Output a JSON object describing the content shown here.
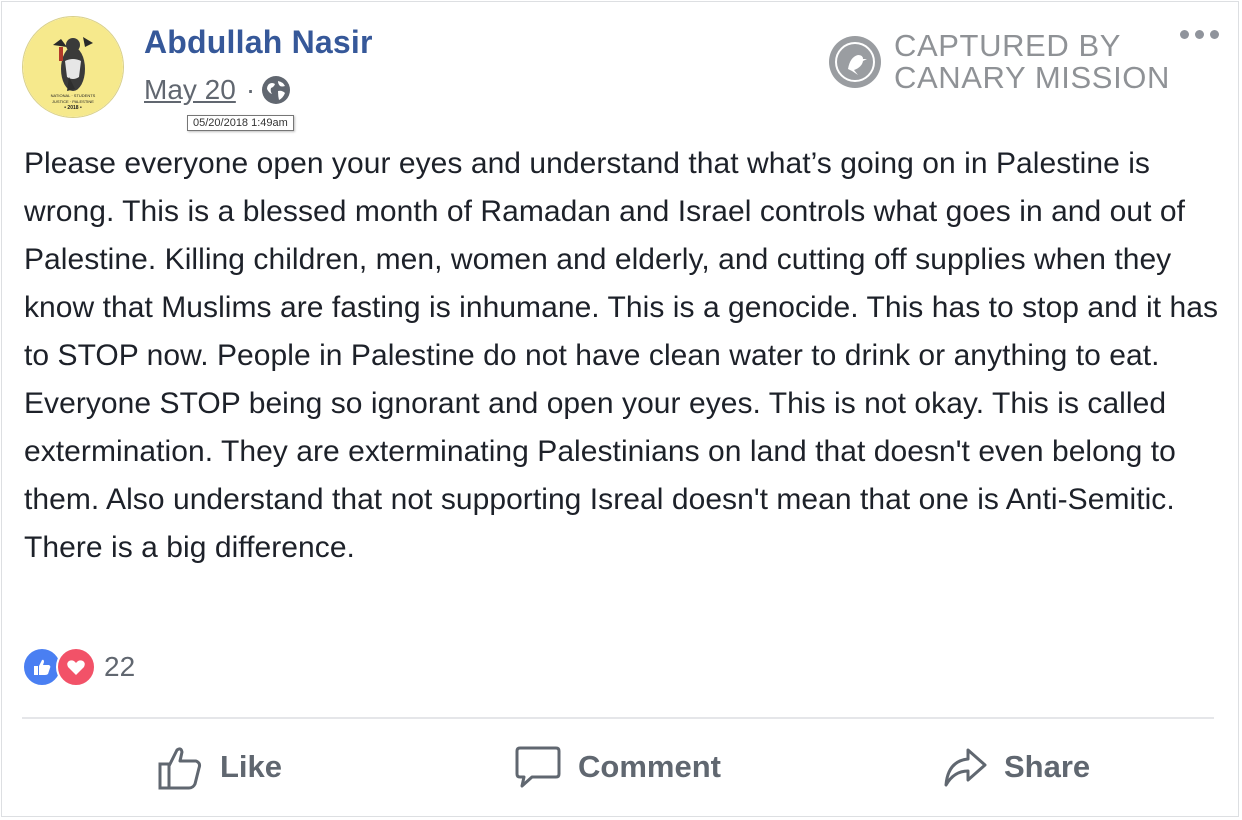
{
  "post": {
    "author": "Abdullah Nasir",
    "date": "May 20",
    "separator": "·",
    "timestamp_tooltip": "05/20/2018 1:49am",
    "audience_icon": "globe-icon",
    "text": "Please everyone open your eyes and understand that what’s going on in Palestine is wrong. This is a blessed month of Ramadan and Israel controls what goes in and out of Palestine. Killing children, men, women and elderly, and cutting off supplies when they know that Muslims are fasting is inhumane. This is a genocide. This has to stop and it has to STOP now. People in Palestine do not have clean water to drink or anything to eat. Everyone STOP being so ignorant and open your eyes. This is not okay. This is called extermination. They are exterminating Palestinians on land that doesn't even belong to them. Also understand that not supporting Isreal doesn't mean that one is Anti-Semitic. There is a big difference."
  },
  "avatar": {
    "badge_lines": [
      "NATIONAL",
      "STUDENTS for",
      "JUSTICE in PALESTINE CONFERENCE",
      "• 2018 •"
    ],
    "bg_color": "#f6e98c"
  },
  "watermark": {
    "line1": "CAPTURED BY",
    "line2": "CANARY MISSION",
    "color": "#8f9296"
  },
  "reactions": {
    "count": "22",
    "icons": [
      "like-reaction-icon",
      "love-reaction-icon"
    ],
    "like_color": "#4a7ff2",
    "love_color": "#f25268"
  },
  "actions": {
    "like": "Like",
    "comment": "Comment",
    "share": "Share"
  },
  "colors": {
    "author": "#365899",
    "text": "#1d2129",
    "muted": "#616770"
  }
}
